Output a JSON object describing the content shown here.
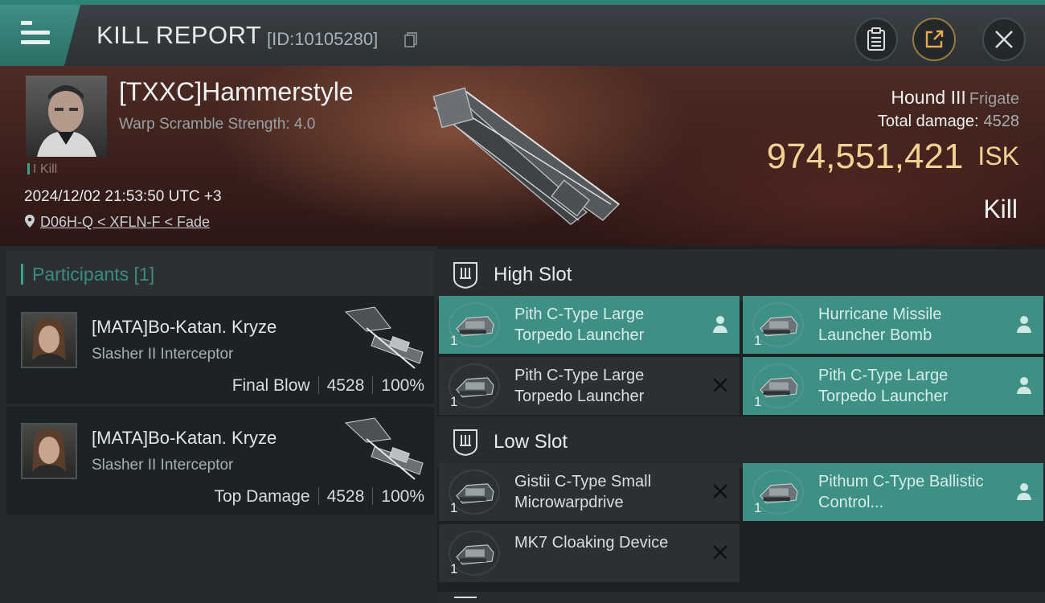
{
  "header": {
    "title": "KILL REPORT",
    "id_label": "[ID:10105280]"
  },
  "victim": {
    "name": "[TXXC]Hammerstyle",
    "scramble": "Warp Scramble Strength: 4.0",
    "kill_count": "I Kill",
    "timestamp": "2024/12/02 21:53:50 UTC +3",
    "location": "D06H-Q < XFLN-F < Fade",
    "ship_name": "Hound III",
    "ship_class": "Frigate",
    "total_damage_label": "Total damage:",
    "total_damage": "4528",
    "isk_value": "974,551,421",
    "isk_unit": "ISK",
    "result": "Kill"
  },
  "participants": {
    "label": "Participants [1]",
    "rows": [
      {
        "name": "[MATA]Bo-Katan. Kryze",
        "ship": "Slasher II Interceptor",
        "role": "Final Blow",
        "damage": "4528",
        "percent": "100%"
      },
      {
        "name": "[MATA]Bo-Katan. Kryze",
        "ship": "Slasher II Interceptor",
        "role": "Top Damage",
        "damage": "4528",
        "percent": "100%"
      }
    ]
  },
  "slots": {
    "high": {
      "label": "High Slot",
      "modules": [
        {
          "name": "Pith C-Type Large Torpedo Launcher",
          "qty": "1",
          "status": "person-icon",
          "active": true
        },
        {
          "name": "Hurricane Missile Launcher Bomb",
          "qty": "1",
          "status": "person-icon",
          "active": true
        },
        {
          "name": "Pith C-Type Large Torpedo Launcher",
          "qty": "1",
          "status": "x-icon",
          "active": false
        },
        {
          "name": "Pith C-Type Large Torpedo Launcher",
          "qty": "1",
          "status": "person-icon",
          "active": true
        }
      ]
    },
    "low": {
      "label": "Low Slot",
      "modules": [
        {
          "name": "Gistii C-Type Small Microwarpdrive",
          "qty": "1",
          "status": "x-icon",
          "active": false
        },
        {
          "name": "Pithum C-Type Ballistic Control...",
          "qty": "1",
          "status": "person-icon",
          "active": true
        },
        {
          "name": "MK7 Cloaking Device",
          "qty": "1",
          "status": "x-icon",
          "active": false
        }
      ]
    }
  },
  "colors": {
    "accent": "#3e8f84",
    "isk": "#f3d293",
    "banner": "#4e2b24"
  }
}
